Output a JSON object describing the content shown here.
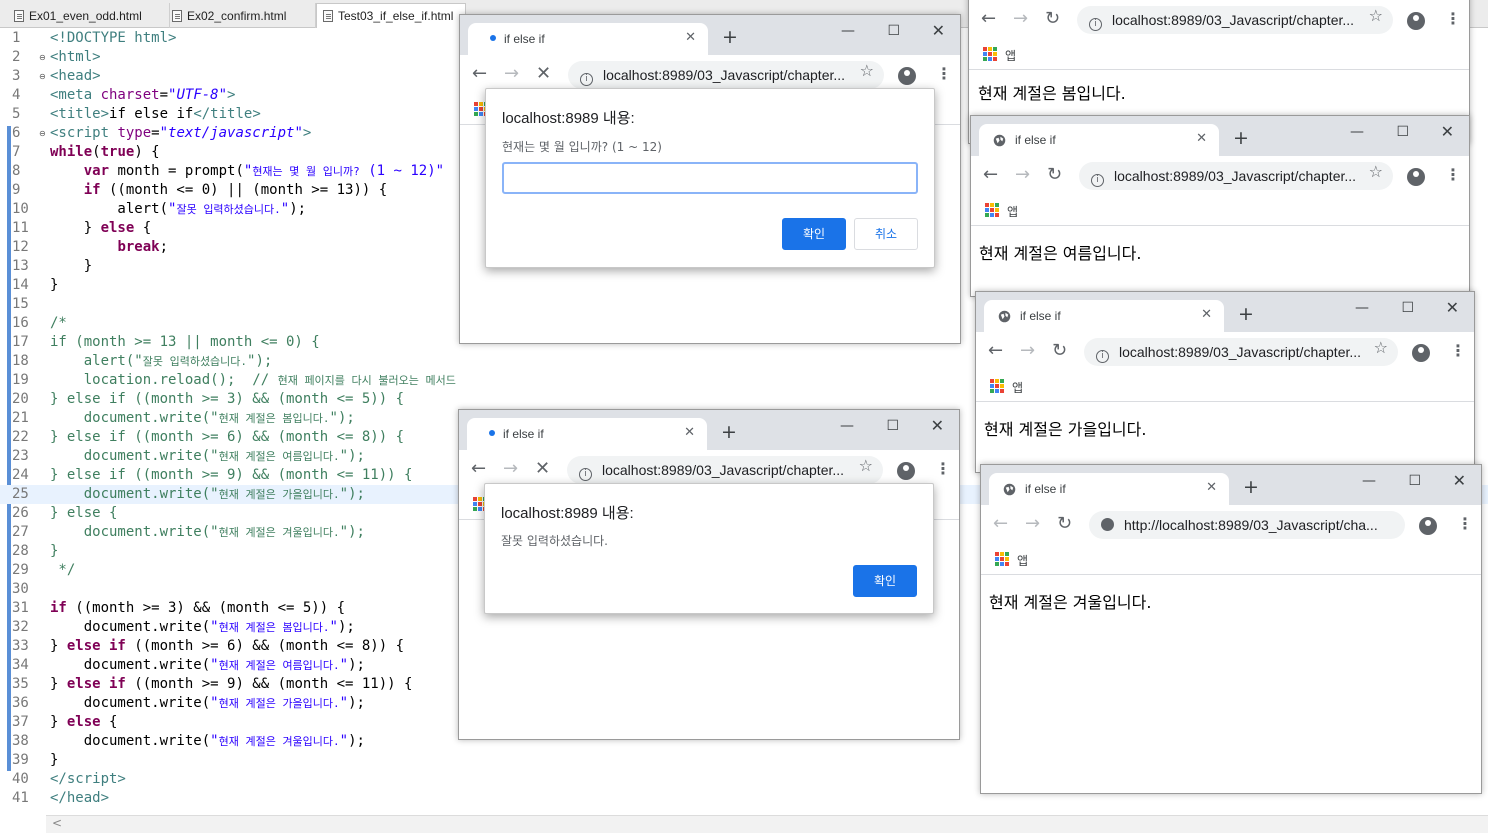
{
  "editor": {
    "tabs": [
      {
        "label": "Ex01_even_odd.html"
      },
      {
        "label": "Ex02_confirm.html"
      },
      {
        "label": "Test03_if_else_if.html"
      }
    ],
    "scroll_arrow": "<",
    "lines": [
      {
        "n": "1",
        "mark": "",
        "html": "<span class='tg'>&lt;!DOCTYPE html&gt;</span>"
      },
      {
        "n": "2",
        "mark": "⊖",
        "html": "<span class='tg'>&lt;html&gt;</span>"
      },
      {
        "n": "3",
        "mark": "⊖",
        "html": "<span class='tg'>&lt;head&gt;</span>"
      },
      {
        "n": "4",
        "mark": "",
        "html": "<span class='tg'>&lt;meta </span><span class='at'>charset</span>=<span class='sti'>\"UTF-8\"</span><span class='tg'>&gt;</span>"
      },
      {
        "n": "5",
        "mark": "",
        "html": "<span class='tg'>&lt;title&gt;</span>if else if<span class='tg'>&lt;/title&gt;</span>"
      },
      {
        "n": "6",
        "mark": "⊖",
        "html": "<span class='tg'>&lt;script </span><span class='at'>type</span>=<span class='sti'>\"text/javascript\"</span><span class='tg'>&gt;</span>"
      },
      {
        "n": "7",
        "mark": "",
        "html": "<span class='kw'>while</span>(<span class='kw'>true</span>) {"
      },
      {
        "n": "8",
        "mark": "",
        "html": "    <span class='kw'>var</span> month = prompt(<span class='st'>\"<span class='small'>현재는 몇 월 입니까?</span> (1 ~ 12)\"</span>"
      },
      {
        "n": "9",
        "mark": "",
        "html": "    <span class='kw'>if</span> ((month &lt;= 0) || (month &gt;= 13)) {"
      },
      {
        "n": "10",
        "mark": "",
        "html": "        alert(<span class='st'>\"<span class='small'>잘못 입력하셨습니다.</span>\"</span>);"
      },
      {
        "n": "11",
        "mark": "",
        "html": "    } <span class='kw'>else</span> {"
      },
      {
        "n": "12",
        "mark": "",
        "html": "        <span class='kw'>break</span>;"
      },
      {
        "n": "13",
        "mark": "",
        "html": "    }"
      },
      {
        "n": "14",
        "mark": "",
        "html": "}"
      },
      {
        "n": "15",
        "mark": "",
        "html": ""
      },
      {
        "n": "16",
        "mark": "",
        "html": "<span class='cm'>/*</span>"
      },
      {
        "n": "17",
        "mark": "",
        "html": "<span class='cm'>if (month &gt;= 13 || month &lt;= 0) {</span>"
      },
      {
        "n": "18",
        "mark": "",
        "html": "<span class='cm'>    alert(\"<span class='small'>잘못 입력하셨습니다.</span>\");</span>"
      },
      {
        "n": "19",
        "mark": "",
        "html": "<span class='cm'>    location.reload();  // <span class='small'>현재 페이지를 다시 불러오는 메서드</span></span>"
      },
      {
        "n": "20",
        "mark": "",
        "html": "<span class='cm'>} else if ((month &gt;= 3) &amp;&amp; (month &lt;= 5)) {</span>"
      },
      {
        "n": "21",
        "mark": "",
        "html": "<span class='cm'>    document.write(\"<span class='small'>현재 계절은 봄입니다.</span>\");</span>"
      },
      {
        "n": "22",
        "mark": "",
        "html": "<span class='cm'>} else if ((month &gt;= 6) &amp;&amp; (month &lt;= 8)) {</span>"
      },
      {
        "n": "23",
        "mark": "",
        "html": "<span class='cm'>    document.write(\"<span class='small'>현재 계절은 여름입니다.</span>\");</span>"
      },
      {
        "n": "24",
        "mark": "",
        "html": "<span class='cm'>} else if ((month &gt;= 9) &amp;&amp; (month &lt;= 11)) {</span>"
      },
      {
        "n": "25",
        "mark": "",
        "html": "<span class='cm'>    document.write(\"<span class='small'>현재 계절은 가을입니다.</span>\");</span>",
        "hl": true
      },
      {
        "n": "26",
        "mark": "",
        "html": "<span class='cm'>} else {</span>"
      },
      {
        "n": "27",
        "mark": "",
        "html": "<span class='cm'>    document.write(\"<span class='small'>현재 계절은 겨울입니다.</span>\");</span>"
      },
      {
        "n": "28",
        "mark": "",
        "html": "<span class='cm'>}</span>"
      },
      {
        "n": "29",
        "mark": "",
        "html": "<span class='cm'> */</span>"
      },
      {
        "n": "30",
        "mark": "",
        "html": ""
      },
      {
        "n": "31",
        "mark": "",
        "html": "<span class='kw'>if</span> ((month &gt;= 3) &amp;&amp; (month &lt;= 5)) {"
      },
      {
        "n": "32",
        "mark": "",
        "html": "    document.write(<span class='st'>\"<span class='small'>현재 계절은 봄입니다.</span>\"</span>);"
      },
      {
        "n": "33",
        "mark": "",
        "html": "} <span class='kw'>else if</span> ((month &gt;= 6) &amp;&amp; (month &lt;= 8)) {"
      },
      {
        "n": "34",
        "mark": "",
        "html": "    document.write(<span class='st'>\"<span class='small'>현재 계절은 여름입니다.</span>\"</span>);"
      },
      {
        "n": "35",
        "mark": "",
        "html": "} <span class='kw'>else if</span> ((month &gt;= 9) &amp;&amp; (month &lt;= 11)) {"
      },
      {
        "n": "36",
        "mark": "",
        "html": "    document.write(<span class='st'>\"<span class='small'>현재 계절은 가을입니다.</span>\"</span>);"
      },
      {
        "n": "37",
        "mark": "",
        "html": "} <span class='kw'>else</span> {"
      },
      {
        "n": "38",
        "mark": "",
        "html": "    document.write(<span class='st'>\"<span class='small'>현재 계절은 겨울입니다.</span>\"</span>);"
      },
      {
        "n": "39",
        "mark": "",
        "html": "}"
      },
      {
        "n": "40",
        "mark": "",
        "html": "<span class='tg'>&lt;/script&gt;</span>"
      },
      {
        "n": "41",
        "mark": "",
        "html": "<span class='tg'>&lt;/head&gt;</span>"
      }
    ]
  },
  "browsers": [
    {
      "id": "spring",
      "tab_title": "",
      "url": "localhost:8989/03_Javascript/chapter...",
      "bookmark": "앱",
      "page_text": "현재 계절은 봄입니다.",
      "loading": false
    },
    {
      "id": "summer",
      "tab_title": "if else if",
      "url": "localhost:8989/03_Javascript/chapter...",
      "bookmark": "앱",
      "page_text": "현재 계절은 여름입니다.",
      "loading": false
    },
    {
      "id": "autumn",
      "tab_title": "if else if",
      "url": "localhost:8989/03_Javascript/chapter...",
      "bookmark": "앱",
      "page_text": "현재 계절은 가을입니다.",
      "loading": false
    },
    {
      "id": "winter",
      "tab_title": "if else if",
      "url": "http://localhost:8989/03_Javascript/cha...",
      "bookmark": "앱",
      "page_text": "현재 계절은 겨울입니다.",
      "loading": false
    },
    {
      "id": "prompt",
      "tab_title": "if else if",
      "url": "localhost:8989/03_Javascript/chapter...",
      "bookmark": "",
      "page_text": "",
      "loading": true
    },
    {
      "id": "alert",
      "tab_title": "if else if",
      "url": "localhost:8989/03_Javascript/chapter...",
      "bookmark": "",
      "page_text": "",
      "loading": true
    }
  ],
  "prompt_dialog": {
    "title": "localhost:8989 내용:",
    "message": "현재는 몇 월 입니까? (1 ~ 12)",
    "input_value": "",
    "ok_label": "확인",
    "cancel_label": "취소"
  },
  "alert_dialog": {
    "title": "localhost:8989 내용:",
    "message": "잘못 입력하셨습니다.",
    "ok_label": "확인"
  },
  "colors": {
    "accent": "#1a73e8",
    "tabstrip": "#dee1e6",
    "keyword": "#7f0055",
    "string": "#2a00ff",
    "comment": "#3f7f5f",
    "tag": "#3f7f7f"
  },
  "icons": {
    "back": "←",
    "forward": "→",
    "reload": "↻",
    "stop": "✕",
    "star": "☆",
    "menu": "⋮",
    "newtab": "+",
    "minimize": "—",
    "maximize": "☐",
    "close": "✕",
    "info": "i"
  }
}
